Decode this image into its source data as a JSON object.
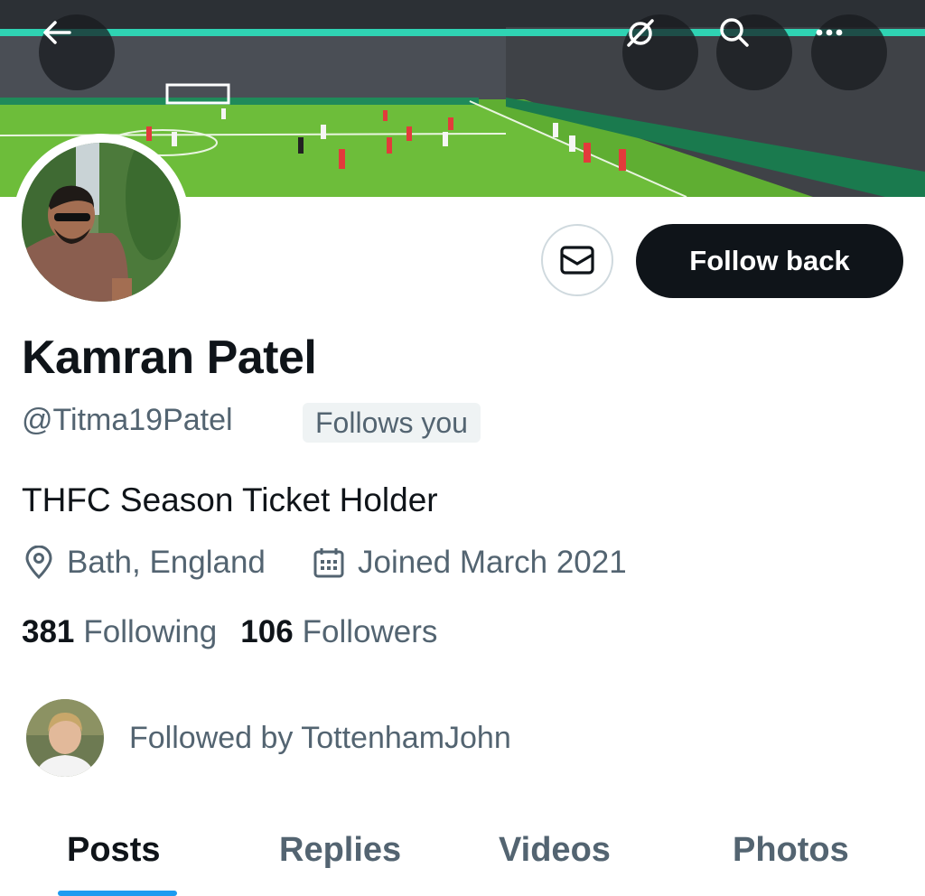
{
  "header": {
    "back_icon": "arrow-left-icon",
    "actions": [
      "unlink-icon",
      "search-icon",
      "more-icon"
    ]
  },
  "profile": {
    "name": "Kamran Patel",
    "handle": "@Titma19Patel",
    "follows_you": "Follows you",
    "bio": "THFC Season Ticket Holder",
    "location": "Bath, England",
    "joined": "Joined March 2021",
    "following_count": "381",
    "following_label": "Following",
    "followers_count": "106",
    "followers_label": "Followers",
    "followed_by": "Followed by TottenhamJohn"
  },
  "actions": {
    "follow_back_label": "Follow back",
    "message_icon": "envelope-icon"
  },
  "tabs": [
    {
      "label": "Posts",
      "active": true
    },
    {
      "label": "Replies",
      "active": false
    },
    {
      "label": "Videos",
      "active": false
    },
    {
      "label": "Photos",
      "active": false
    }
  ],
  "colors": {
    "primary_text": "#0f1419",
    "secondary_text": "#536471",
    "accent": "#1d9bf0",
    "button_dark": "#0f1419"
  }
}
